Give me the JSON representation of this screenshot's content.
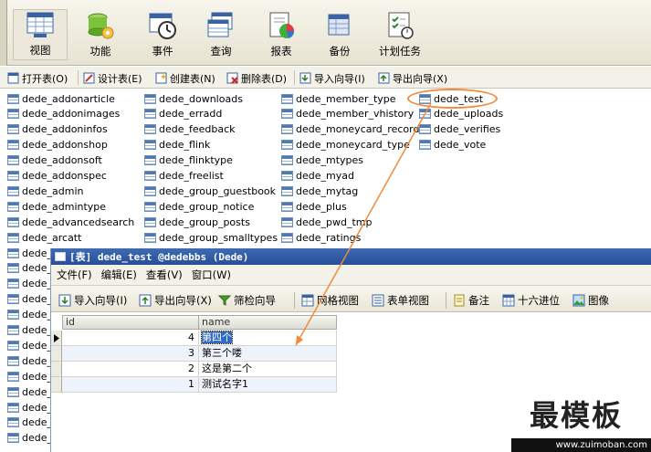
{
  "toolbar": {
    "buttons": [
      {
        "label": "视图",
        "icon": "grid-view-icon"
      },
      {
        "label": "功能",
        "icon": "function-gear-icon"
      },
      {
        "label": "事件",
        "icon": "event-clock-icon"
      },
      {
        "label": "查询",
        "icon": "query-icon"
      },
      {
        "label": "报表",
        "icon": "report-icon"
      },
      {
        "label": "备份",
        "icon": "backup-icon"
      },
      {
        "label": "计划任务",
        "icon": "schedule-icon"
      }
    ]
  },
  "object_toolbar": {
    "open_table": "打开表(O)",
    "design_table": "设计表(E)",
    "create_table": "创建表(N)",
    "delete_table": "删除表(D)",
    "import_wizard": "导入向导(I)",
    "export_wizard": "导出向导(X)"
  },
  "tables": {
    "col1": [
      "dede_addonarticle",
      "dede_addonimages",
      "dede_addoninfos",
      "dede_addonshop",
      "dede_addonsoft",
      "dede_addonspec",
      "dede_admin",
      "dede_admintype",
      "dede_advancedsearch",
      "dede_arcatt"
    ],
    "col1_truncated": [
      "dede_",
      "dede_",
      "dede_",
      "dede_",
      "dede_",
      "dede_",
      "dede_",
      "dede_",
      "dede_",
      "dede_",
      "dede_",
      "dede_",
      "dede_"
    ],
    "col2": [
      "dede_downloads",
      "dede_erradd",
      "dede_feedback",
      "dede_flink",
      "dede_flinktype",
      "dede_freelist",
      "dede_group_guestbook",
      "dede_group_notice",
      "dede_group_posts",
      "dede_group_smalltypes"
    ],
    "col3": [
      "dede_member_type",
      "dede_member_vhistory",
      "dede_moneycard_record",
      "dede_moneycard_type",
      "dede_mtypes",
      "dede_myad",
      "dede_mytag",
      "dede_plus",
      "dede_pwd_tmp",
      "dede_ratings"
    ],
    "col4": [
      "dede_test",
      "dede_uploads",
      "dede_verifies",
      "dede_vote"
    ]
  },
  "table_window": {
    "title": "[表] dede_test @dedebbs (Dede)",
    "menu": [
      "文件(F)",
      "编辑(E)",
      "查看(V)",
      "窗口(W)"
    ],
    "toolbar": {
      "import_wizard": "导入向导(I)",
      "export_wizard": "导出向导(X)",
      "filter_wizard": "筛检向导",
      "grid_view": "网格视图",
      "form_view": "表单视图",
      "memo": "备注",
      "hex": "十六进位",
      "image": "图像"
    },
    "grid": {
      "columns": [
        "id",
        "name"
      ],
      "rows": [
        {
          "id": "4",
          "name": "第四个"
        },
        {
          "id": "3",
          "name": "第三个喽"
        },
        {
          "id": "2",
          "name": "这是第二个"
        },
        {
          "id": "1",
          "name": "测试名字1"
        }
      ]
    }
  },
  "watermark": {
    "title": "最模板",
    "url": "www.zuimoban.com"
  },
  "colors": {
    "highlight": "#f08a3c",
    "titlebar": "#2f5ca5",
    "selection": "#316ac5"
  }
}
